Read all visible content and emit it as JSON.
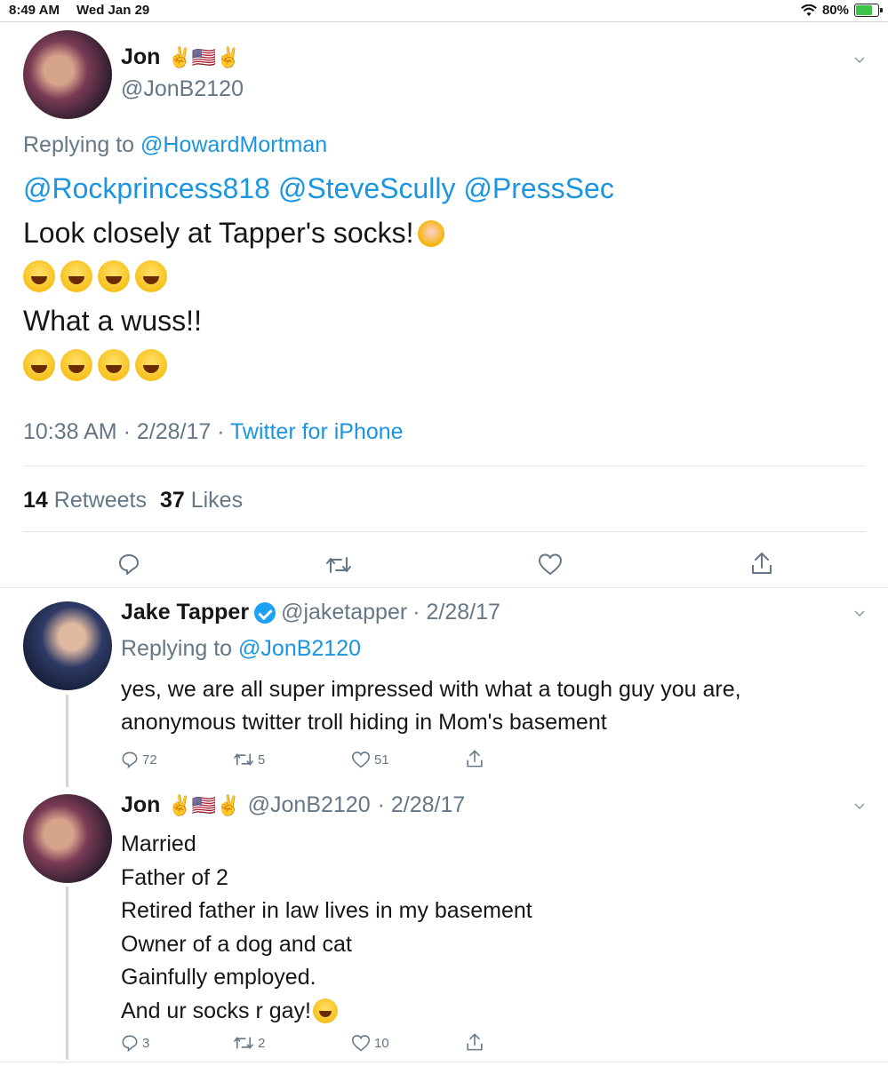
{
  "status_bar": {
    "time": "8:49 AM",
    "date": "Wed Jan 29",
    "battery": "80%",
    "battery_level": 0.8
  },
  "tweet_main": {
    "author_name": "Jon",
    "author_emojis": "✌️🇺🇸✌️",
    "author_handle": "@JonB2120",
    "replying_prefix": "Replying to",
    "replying_to": "@HowardMortman",
    "mentions": "@Rockprincess818 @SteveScully @PressSec",
    "line1": "Look closely at Tapper's socks!",
    "line2": "What a wuss!!",
    "timestamp": "10:38 AM · 2/28/17 ·",
    "source": "Twitter for iPhone",
    "retweets_count": "14",
    "retweets_label": "Retweets",
    "likes_count": "37",
    "likes_label": "Likes"
  },
  "reply_tapper": {
    "author_name": "Jake Tapper",
    "author_handle": "@jaketapper",
    "date": "· 2/28/17",
    "replying_prefix": "Replying to",
    "replying_to": "@JonB2120",
    "text_line1": "yes, we are all super impressed with what a tough guy you are,",
    "text_line2": "anonymous twitter troll hiding in Mom's basement",
    "replies": "72",
    "retweets": "5",
    "likes": "51"
  },
  "reply_jon": {
    "author_name": "Jon",
    "author_emojis": "✌️🇺🇸✌️",
    "author_handle": "@JonB2120",
    "date": "· 2/28/17",
    "lines": [
      "Married",
      "Father of 2",
      "Retired father in law lives in my basement",
      "Owner of a dog and cat",
      "Gainfully employed.",
      "And ur socks r gay!"
    ],
    "replies": "3",
    "retweets": "2",
    "likes": "10"
  },
  "colors": {
    "link": "#1b95e0",
    "muted": "#657786",
    "divider": "#e1e8ed"
  }
}
